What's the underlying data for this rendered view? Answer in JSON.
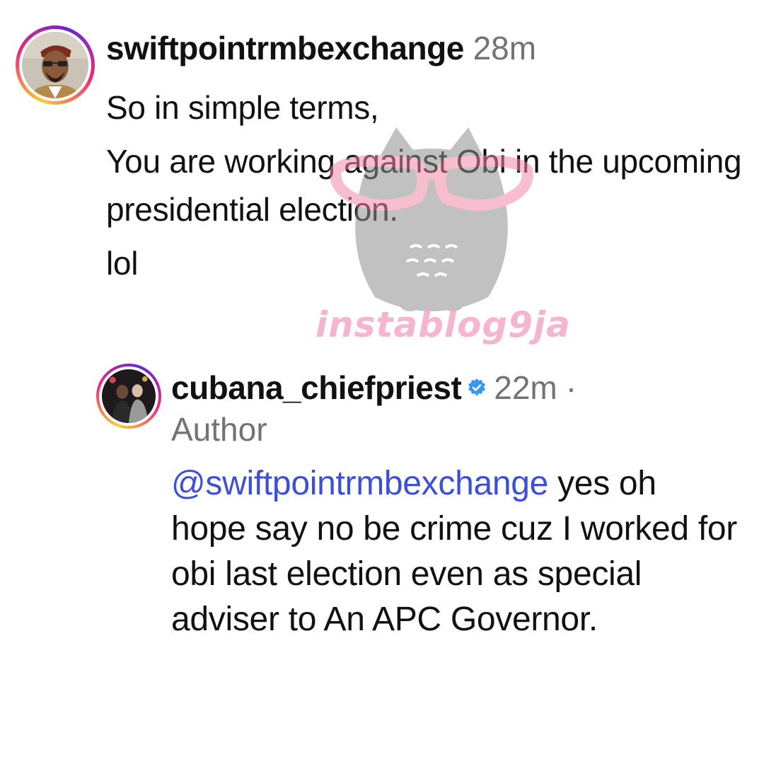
{
  "comments": [
    {
      "username": "swiftpointrmbexchange",
      "time": "28m",
      "avatar_icon": "profile-avatar",
      "lines": [
        "So in simple terms,",
        "You are working against Obi in the upcoming presidential election.",
        "lol"
      ]
    },
    {
      "username": "cubana_chiefpriest",
      "verified": true,
      "time": "22m",
      "separator": "·",
      "author_label": "Author",
      "avatar_icon": "profile-avatar",
      "mention": "@swiftpointrmbexchange",
      "text": " yes oh hope say no be crime cuz I worked for obi last election even as special adviser to An APC Governor."
    }
  ],
  "watermark": {
    "text": "instablog9ja",
    "icon": "owl-icon"
  },
  "colors": {
    "mention": "#3b4fd9",
    "verified": "#3897f0",
    "secondary_text": "#737373",
    "watermark_text": "#f4a9c7"
  }
}
